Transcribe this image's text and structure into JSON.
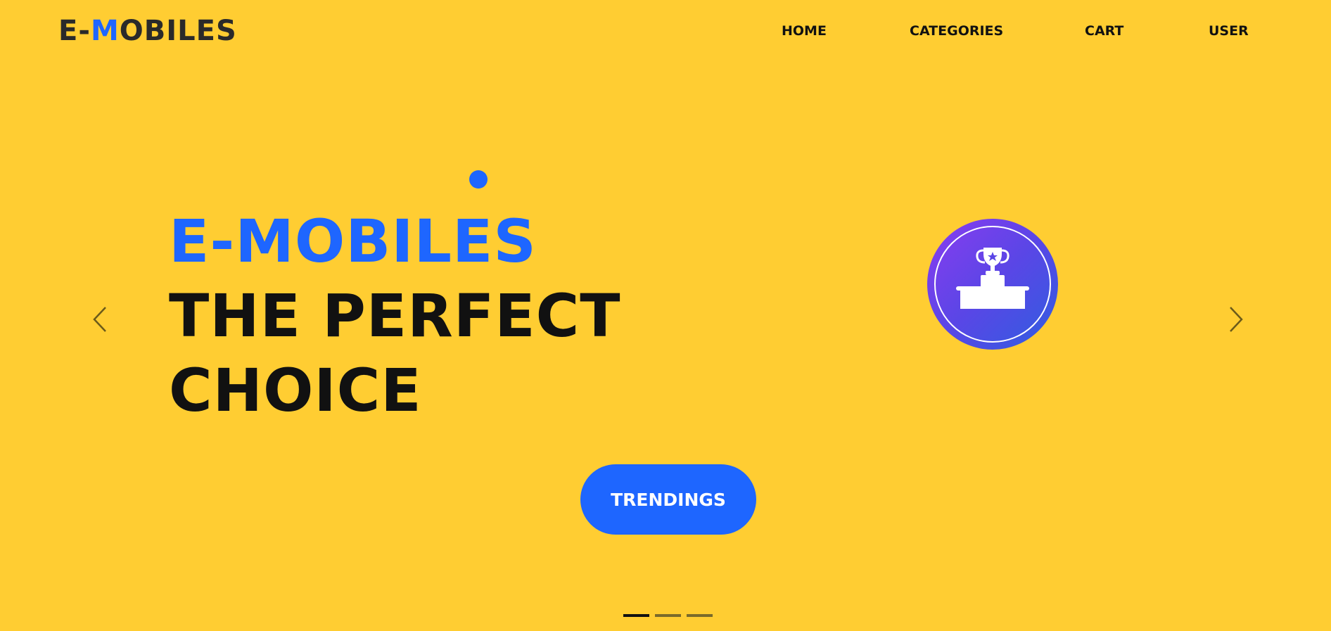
{
  "navbar": {
    "logo_prefix": "E-",
    "logo_accent": "M",
    "logo_suffix": "OBILES",
    "links": [
      {
        "label": "HOME"
      },
      {
        "label": "CATEGORIES"
      },
      {
        "label": "CART"
      },
      {
        "label": "USER"
      }
    ]
  },
  "hero": {
    "title_line1": "E-MOBILES",
    "title_line2": "THE PERFECT",
    "title_line3": "CHOICE",
    "cta_label": "TRENDINGS",
    "badge_icon": "trophy-podium-icon"
  },
  "carousel": {
    "prev_icon": "chevron-left-icon",
    "next_icon": "chevron-right-icon",
    "slide_count": 3,
    "active_slide": 1
  },
  "colors": {
    "background": "#ffcd32",
    "accent": "#1e66ff",
    "text": "#111111",
    "badge_gradient_start": "#8a3cf0",
    "badge_gradient_end": "#2f5ee0"
  }
}
